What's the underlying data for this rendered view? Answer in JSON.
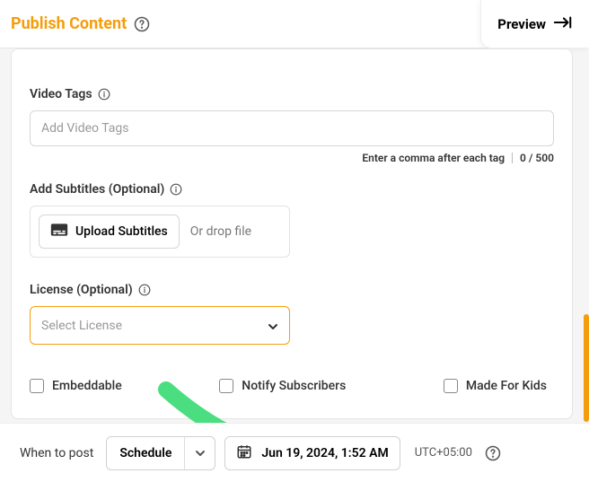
{
  "header": {
    "title": "Publish Content",
    "preview_label": "Preview"
  },
  "video_tags": {
    "label": "Video Tags",
    "placeholder": "Add Video Tags",
    "hint": "Enter a comma after each tag",
    "counter": "0 / 500"
  },
  "subtitles": {
    "label": "Add Subtitles (Optional)",
    "upload_label": "Upload Subtitles",
    "drop_text": "Or drop file"
  },
  "license": {
    "label": "License (Optional)",
    "placeholder": "Select License"
  },
  "checkboxes": {
    "embeddable": "Embeddable",
    "notify": "Notify Subscribers",
    "kids": "Made For Kids"
  },
  "footer": {
    "when_label": "When to post",
    "schedule_value": "Schedule",
    "date_value": "Jun 19, 2024, 1:52 AM",
    "timezone": "UTC+05:00"
  },
  "colors": {
    "accent": "#f59e0b",
    "arrow": "#4ade80"
  }
}
